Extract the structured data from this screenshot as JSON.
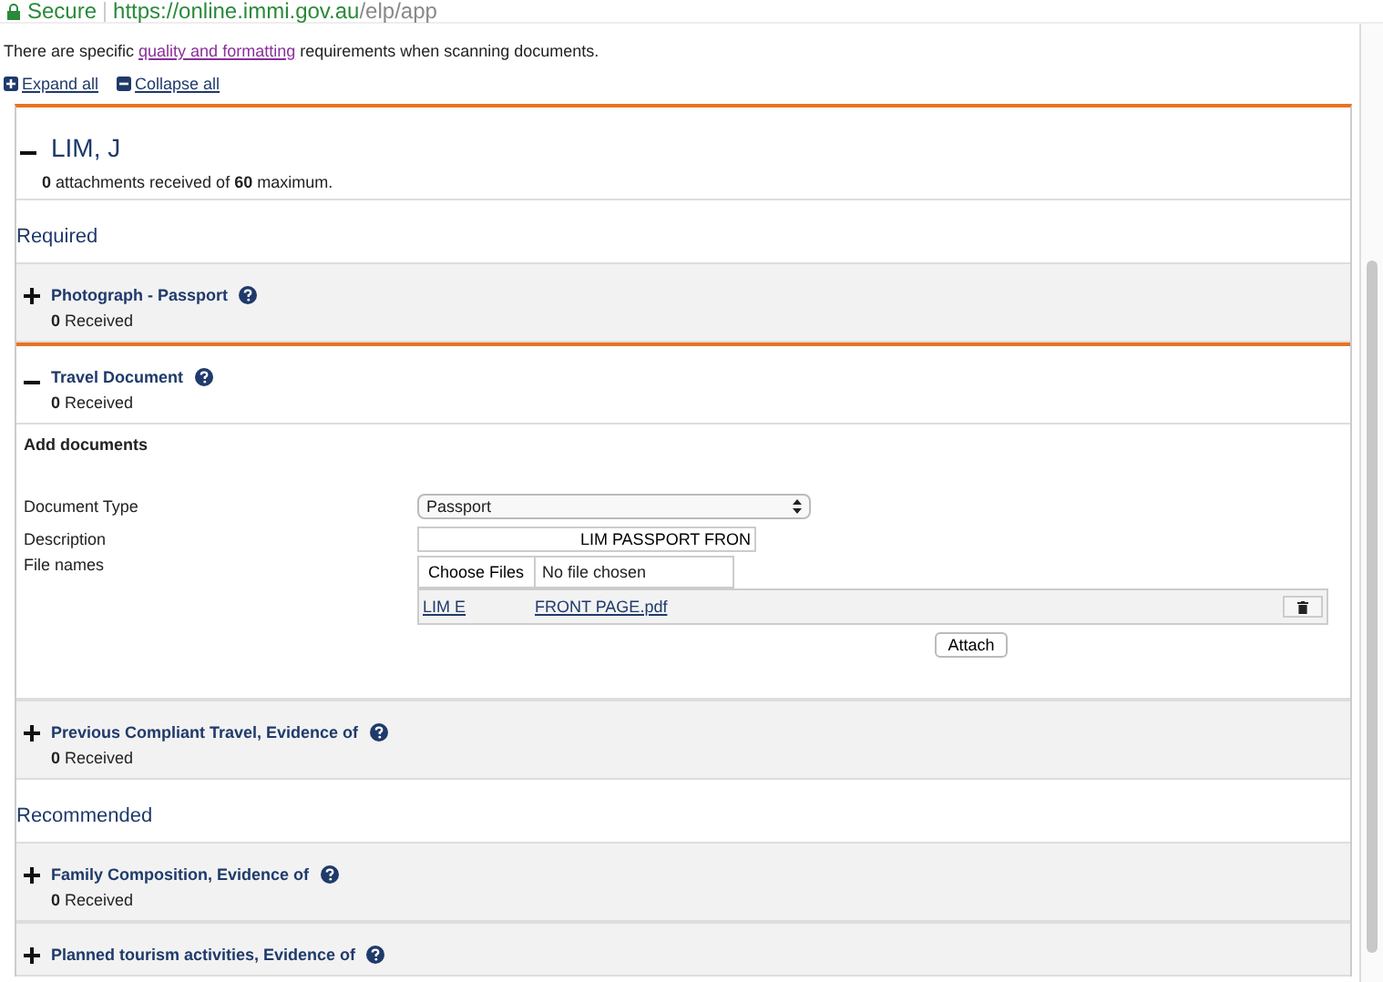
{
  "address_bar": {
    "secure_label": "Secure",
    "url_host": "https://online.immi.gov.au",
    "url_path": "/elp/app"
  },
  "notice": {
    "before": "There are specific ",
    "link": "quality and formatting",
    "after": " requirements when scanning documents."
  },
  "toolbar": [
    {
      "kind": "expand",
      "label": "Expand all"
    },
    {
      "kind": "collapse",
      "label": "Collapse all"
    }
  ],
  "applicant": {
    "name": "LIM, J",
    "expanded": true,
    "summary": "**0** attachments received of **60** maximum."
  },
  "groups": [
    {
      "heading": "Required",
      "items": [
        {
          "title": "Photograph - Passport",
          "expanded": false,
          "count": "0",
          "count_label": "Received"
        },
        {
          "title": "Travel Document",
          "expanded": true,
          "count": "0",
          "count_label": "Received",
          "form": {
            "heading": "Add documents",
            "document_type_label": "Document Type",
            "document_type": "Passport",
            "description_label": "Description",
            "description": "LIM PASSPORT FRON",
            "files_label": "File names",
            "choose_button": "Choose Files",
            "no_file": "No file chosen",
            "attachments": [
              {
                "name_start": "LIM E",
                "name_end": "FRONT PAGE.pdf"
              }
            ],
            "attach_button": "Attach"
          }
        },
        {
          "title": "Previous Compliant Travel, Evidence of",
          "expanded": false,
          "count": "0",
          "count_label": "Received"
        }
      ]
    },
    {
      "heading": "Recommended",
      "items": [
        {
          "title": "Family Composition, Evidence of",
          "expanded": false,
          "count": "0",
          "count_label": "Received"
        },
        {
          "title": "Planned tourism activities, Evidence of",
          "expanded": false
        }
      ]
    }
  ]
}
